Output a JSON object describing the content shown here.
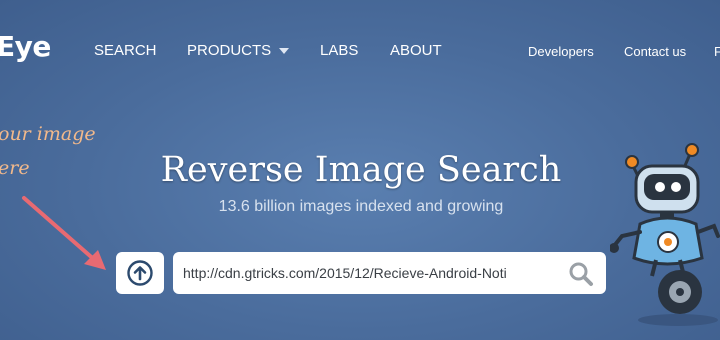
{
  "header": {
    "logo_text": "Eye",
    "nav": [
      {
        "label": "SEARCH"
      },
      {
        "label": "PRODUCTS"
      },
      {
        "label": "LABS"
      },
      {
        "label": "ABOUT"
      }
    ],
    "right_links": [
      {
        "label": "Developers"
      },
      {
        "label": "Contact us"
      }
    ]
  },
  "hint": {
    "line1": "our image",
    "line2": "ere"
  },
  "hero": {
    "title": "Reverse Image Search",
    "subtitle": "13.6 billion images indexed and growing"
  },
  "search": {
    "value": "http://cdn.gtricks.com/2015/12/Recieve-Android-Noti"
  },
  "icons": {
    "upload": "upload-arrow-icon",
    "search": "magnifier-icon",
    "products_caret": "chevron-down-icon",
    "hint_arrow": "pointer-arrow-icon",
    "mascot": "robot-mascot"
  },
  "colors": {
    "background": "#4a6c9c",
    "hint_text": "#f2b98b",
    "arrow": "#e86a72",
    "icon_gray": "#9aa0a6"
  }
}
